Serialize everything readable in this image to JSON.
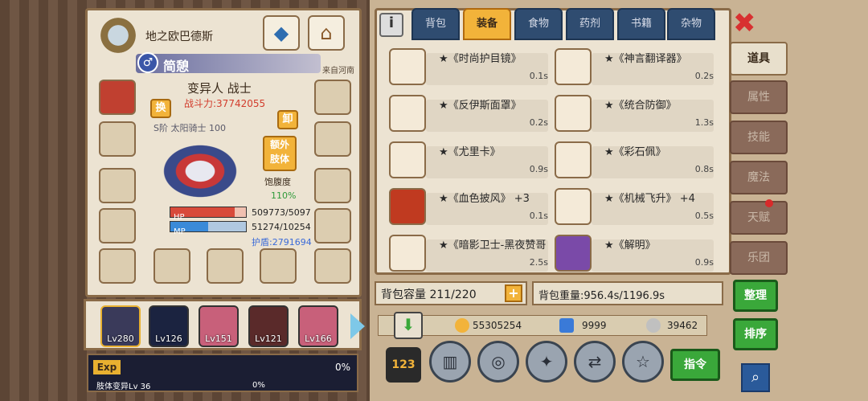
{
  "hero": {
    "name": "地之欧巴德斯",
    "class_name": "简憩",
    "origin": "来自河南",
    "title": "变异人 战士",
    "power": "战斗力:37742055",
    "rank": "S阶 太阳骑士",
    "rank_value": "100",
    "swap_label": "换",
    "unequip_label": "卸",
    "extra_body_label": "额外\n肢体",
    "satiety_label": "饱腹度",
    "satiety_value": "110%",
    "hp_label": "HP",
    "hp_value": "509773/5097",
    "mp_label": "MP",
    "mp_value": "51274/10254",
    "shield": "护盾:2791694"
  },
  "pets": [
    {
      "level": "Lv280",
      "selected": true
    },
    {
      "level": "Lv126",
      "selected": false
    },
    {
      "level": "Lv151",
      "selected": false
    },
    {
      "level": "Lv121",
      "selected": false
    },
    {
      "level": "Lv166",
      "selected": false
    }
  ],
  "exp": {
    "label": "Exp",
    "percent": "0%",
    "sub_label": "肢体变异Lv 36",
    "sub_percent": "0%"
  },
  "tabs": [
    {
      "label": "背包"
    },
    {
      "label": "装备",
      "active": true
    },
    {
      "label": "食物"
    },
    {
      "label": "药剂"
    },
    {
      "label": "书籍"
    },
    {
      "label": "杂物"
    }
  ],
  "items": [
    {
      "name": "★《时尚护目镜》",
      "weight": "0.1s"
    },
    {
      "name": "★《神言翻译器》",
      "weight": "0.2s"
    },
    {
      "name": "★《反伊斯面罩》",
      "weight": "0.2s"
    },
    {
      "name": "★《统合防御》",
      "weight": "1.3s"
    },
    {
      "name": "★《尤里卡》",
      "weight": "0.9s"
    },
    {
      "name": "★《彩石佩》",
      "weight": "0.8s"
    },
    {
      "name": "★《血色披风》 +3",
      "weight": "0.1s"
    },
    {
      "name": "★《机械飞升》 +4",
      "weight": "0.5s"
    },
    {
      "name": "★《暗影卫士-黑夜赞哥",
      "weight": "2.5s"
    },
    {
      "name": "★《解明》",
      "weight": "0.9s"
    }
  ],
  "bag": {
    "capacity": "背包容量 211/220",
    "weight": "背包重量:956.4s/1196.9s"
  },
  "currency": {
    "gold": "55305254",
    "diamond": "9999",
    "silver": "39462"
  },
  "command_label": "指令",
  "side_tabs": [
    {
      "label": "道具",
      "active": true
    },
    {
      "label": "属性"
    },
    {
      "label": "技能"
    },
    {
      "label": "魔法"
    },
    {
      "label": "天赋"
    },
    {
      "label": "乐团"
    }
  ],
  "organize_label": "整理",
  "sort_label": "排序",
  "colors": {
    "accent": "#f2b33a",
    "tab": "#2f4c70",
    "green": "#3aa83a",
    "close": "#d83030"
  }
}
